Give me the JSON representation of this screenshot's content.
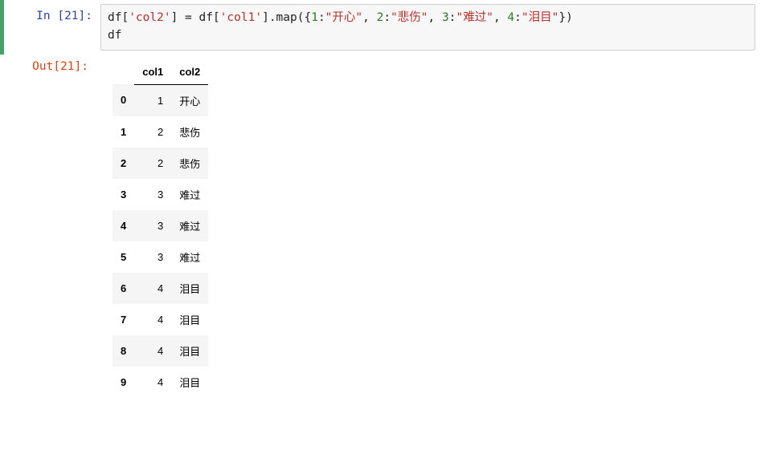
{
  "input": {
    "prompt_prefix": "In  [",
    "exec_count": "21",
    "prompt_suffix": "]:",
    "code_tokens": [
      {
        "t": "df[",
        "c": "c-plain"
      },
      {
        "t": "'col2'",
        "c": "c-str"
      },
      {
        "t": "] = df[",
        "c": "c-plain"
      },
      {
        "t": "'col1'",
        "c": "c-str"
      },
      {
        "t": "].map({",
        "c": "c-plain"
      },
      {
        "t": "1",
        "c": "c-num"
      },
      {
        "t": ":",
        "c": "c-plain"
      },
      {
        "t": "\"开心\"",
        "c": "c-str"
      },
      {
        "t": ", ",
        "c": "c-plain"
      },
      {
        "t": "2",
        "c": "c-num"
      },
      {
        "t": ":",
        "c": "c-plain"
      },
      {
        "t": "\"悲伤\"",
        "c": "c-str"
      },
      {
        "t": ", ",
        "c": "c-plain"
      },
      {
        "t": "3",
        "c": "c-num"
      },
      {
        "t": ":",
        "c": "c-plain"
      },
      {
        "t": "\"难过\"",
        "c": "c-str"
      },
      {
        "t": ", ",
        "c": "c-plain"
      },
      {
        "t": "4",
        "c": "c-num"
      },
      {
        "t": ":",
        "c": "c-plain"
      },
      {
        "t": "\"泪目\"",
        "c": "c-str"
      },
      {
        "t": "})\n",
        "c": "c-plain"
      },
      {
        "t": "df",
        "c": "c-plain"
      }
    ]
  },
  "output": {
    "prompt_prefix": "Out[",
    "exec_count": "21",
    "prompt_suffix": "]:"
  },
  "chart_data": {
    "type": "table",
    "columns": [
      "col1",
      "col2"
    ],
    "index": [
      "0",
      "1",
      "2",
      "3",
      "4",
      "5",
      "6",
      "7",
      "8",
      "9"
    ],
    "rows": [
      {
        "col1": "1",
        "col2": "开心"
      },
      {
        "col1": "2",
        "col2": "悲伤"
      },
      {
        "col1": "2",
        "col2": "悲伤"
      },
      {
        "col1": "3",
        "col2": "难过"
      },
      {
        "col1": "3",
        "col2": "难过"
      },
      {
        "col1": "3",
        "col2": "难过"
      },
      {
        "col1": "4",
        "col2": "泪目"
      },
      {
        "col1": "4",
        "col2": "泪目"
      },
      {
        "col1": "4",
        "col2": "泪目"
      },
      {
        "col1": "4",
        "col2": "泪目"
      }
    ]
  }
}
